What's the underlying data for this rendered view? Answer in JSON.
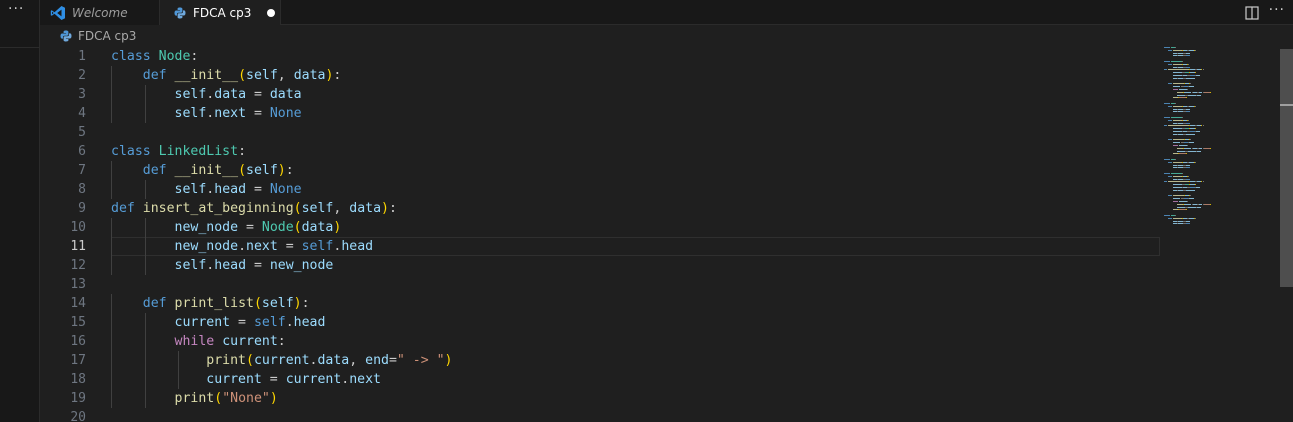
{
  "sidebar": {
    "more_label": "···"
  },
  "tabs": {
    "welcome": {
      "label": "Welcome"
    },
    "file": {
      "label": "FDCA cp3",
      "dirty": true
    }
  },
  "tab_actions": {
    "more_label": "···"
  },
  "breadcrumb": {
    "file": "FDCA cp3"
  },
  "editor": {
    "active_line": 11,
    "line_numbers": [
      "1",
      "2",
      "3",
      "4",
      "5",
      "6",
      "7",
      "8",
      "9",
      "10",
      "11",
      "12",
      "13",
      "14",
      "15",
      "16",
      "17",
      "18",
      "19",
      "20"
    ],
    "lines": [
      [
        [
          "kw",
          "class"
        ],
        [
          "pun",
          " "
        ],
        [
          "cls",
          "Node"
        ],
        [
          "pun",
          ":"
        ]
      ],
      [
        [
          "pun",
          "    "
        ],
        [
          "kw",
          "def"
        ],
        [
          "pun",
          " "
        ],
        [
          "fn",
          "__init__"
        ],
        [
          "brk",
          "("
        ],
        [
          "var",
          "self"
        ],
        [
          "pun",
          ", "
        ],
        [
          "var",
          "data"
        ],
        [
          "brk",
          ")"
        ],
        [
          "pun",
          ":"
        ]
      ],
      [
        [
          "pun",
          "        "
        ],
        [
          "var",
          "self"
        ],
        [
          "pun",
          "."
        ],
        [
          "var",
          "data"
        ],
        [
          "pun",
          " = "
        ],
        [
          "var",
          "data"
        ]
      ],
      [
        [
          "pun",
          "        "
        ],
        [
          "var",
          "self"
        ],
        [
          "pun",
          "."
        ],
        [
          "var",
          "next"
        ],
        [
          "pun",
          " = "
        ],
        [
          "kw",
          "None"
        ]
      ],
      [],
      [
        [
          "kw",
          "class"
        ],
        [
          "pun",
          " "
        ],
        [
          "cls",
          "LinkedList"
        ],
        [
          "pun",
          ":"
        ]
      ],
      [
        [
          "pun",
          "    "
        ],
        [
          "kw",
          "def"
        ],
        [
          "pun",
          " "
        ],
        [
          "fn",
          "__init__"
        ],
        [
          "brk",
          "("
        ],
        [
          "var",
          "self"
        ],
        [
          "brk",
          ")"
        ],
        [
          "pun",
          ":"
        ]
      ],
      [
        [
          "pun",
          "        "
        ],
        [
          "var",
          "self"
        ],
        [
          "pun",
          "."
        ],
        [
          "var",
          "head"
        ],
        [
          "pun",
          " = "
        ],
        [
          "kw",
          "None"
        ]
      ],
      [
        [
          "kw",
          "def"
        ],
        [
          "pun",
          " "
        ],
        [
          "fn",
          "insert_at_beginning"
        ],
        [
          "brk",
          "("
        ],
        [
          "var",
          "self"
        ],
        [
          "pun",
          ", "
        ],
        [
          "var",
          "data"
        ],
        [
          "brk",
          ")"
        ],
        [
          "pun",
          ":"
        ]
      ],
      [
        [
          "pun",
          "        "
        ],
        [
          "var",
          "new_node"
        ],
        [
          "pun",
          " = "
        ],
        [
          "cls",
          "Node"
        ],
        [
          "brk",
          "("
        ],
        [
          "var",
          "data"
        ],
        [
          "brk",
          ")"
        ]
      ],
      [
        [
          "pun",
          "        "
        ],
        [
          "var",
          "new_node"
        ],
        [
          "pun",
          "."
        ],
        [
          "var",
          "next"
        ],
        [
          "pun",
          " = "
        ],
        [
          "kw",
          "self"
        ],
        [
          "pun",
          "."
        ],
        [
          "var",
          "head"
        ]
      ],
      [
        [
          "pun",
          "        "
        ],
        [
          "var",
          "self"
        ],
        [
          "pun",
          "."
        ],
        [
          "var",
          "head"
        ],
        [
          "pun",
          " = "
        ],
        [
          "var",
          "new_node"
        ]
      ],
      [],
      [
        [
          "pun",
          "    "
        ],
        [
          "kw",
          "def"
        ],
        [
          "pun",
          " "
        ],
        [
          "fn",
          "print_list"
        ],
        [
          "brk",
          "("
        ],
        [
          "var",
          "self"
        ],
        [
          "brk",
          ")"
        ],
        [
          "pun",
          ":"
        ]
      ],
      [
        [
          "pun",
          "        "
        ],
        [
          "var",
          "current"
        ],
        [
          "pun",
          " = "
        ],
        [
          "kw",
          "self"
        ],
        [
          "pun",
          "."
        ],
        [
          "var",
          "head"
        ]
      ],
      [
        [
          "pun",
          "        "
        ],
        [
          "ctl",
          "while"
        ],
        [
          "pun",
          " "
        ],
        [
          "var",
          "current"
        ],
        [
          "pun",
          ":"
        ]
      ],
      [
        [
          "pun",
          "            "
        ],
        [
          "fn",
          "print"
        ],
        [
          "brk",
          "("
        ],
        [
          "var",
          "current"
        ],
        [
          "pun",
          "."
        ],
        [
          "var",
          "data"
        ],
        [
          "pun",
          ", "
        ],
        [
          "var",
          "end"
        ],
        [
          "pun",
          "="
        ],
        [
          "str",
          "\" -> \""
        ],
        [
          "brk",
          ")"
        ]
      ],
      [
        [
          "pun",
          "            "
        ],
        [
          "var",
          "current"
        ],
        [
          "pun",
          " = "
        ],
        [
          "var",
          "current"
        ],
        [
          "pun",
          "."
        ],
        [
          "var",
          "next"
        ]
      ],
      [
        [
          "pun",
          "        "
        ],
        [
          "fn",
          "print"
        ],
        [
          "brk",
          "("
        ],
        [
          "str",
          "\"None\""
        ],
        [
          "brk",
          ")"
        ]
      ],
      []
    ]
  },
  "colors": {
    "background": "#1f1f1f",
    "keyword": "#569cd6",
    "control": "#c586c0",
    "class": "#4ec9b0",
    "function": "#dcdcaa",
    "variable": "#9cdcfe",
    "string": "#ce9178",
    "bracket": "#ffd700"
  }
}
